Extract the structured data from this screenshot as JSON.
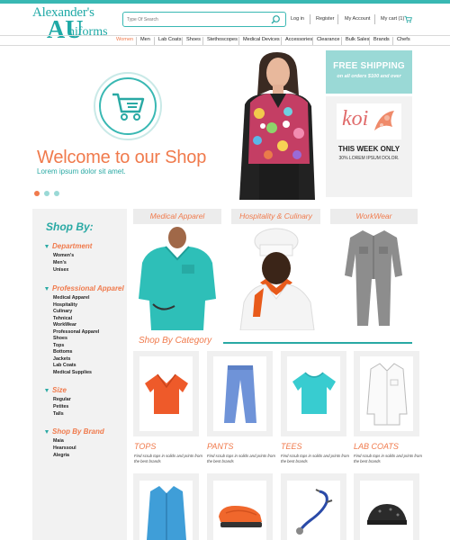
{
  "brand": {
    "line1": "Alexander's",
    "letter_a": "A",
    "letter_u": "U",
    "line2": "niforms"
  },
  "search": {
    "placeholder": "Type Of Search"
  },
  "header_links": {
    "login": "Log in",
    "register": "Register",
    "account": "My Account",
    "cart": "My cart (1)"
  },
  "nav": [
    "Women",
    "Men",
    "Lab Coats",
    "Shoes",
    "Stethoscopes",
    "Medical Devices",
    "Accessories",
    "Clearance",
    "Bulk Sales",
    "Brands",
    "Chefs"
  ],
  "hero": {
    "title": "Welcome to our Shop",
    "subtitle": "Lorem ipsum dolor sit amet.",
    "dots": [
      "active",
      "inactive",
      "inactive"
    ]
  },
  "promo": {
    "shipping_title": "FREE SHIPPING",
    "shipping_sub": "on all orders $100 and over",
    "brand": "koi",
    "this_week": "THIS WEEK ONLY",
    "discount": "30% LOREM IPSUM DOLOR."
  },
  "sidebar": {
    "title": "Shop By:",
    "department": {
      "title": "Department",
      "items": [
        "Women's",
        "Men's",
        "Unisex"
      ]
    },
    "professional": {
      "title": "Professional Apparel",
      "items": [
        "Medical Apparel",
        "Hospitality",
        "Culinary",
        "Tehnical",
        "WorkWear",
        "Professonal Apparel",
        "Shoes",
        "Tops",
        "Bottoms",
        "Jackets",
        "Lab Coats",
        "Medical Supplies"
      ]
    },
    "size": {
      "title": "Size",
      "items": [
        "Regular",
        "Petites",
        "Talls"
      ]
    },
    "brand": {
      "title": "Shop By Brand",
      "items": [
        "Maia",
        "Hearssoul",
        "Alegria"
      ]
    }
  },
  "categories": [
    "Medical Apparel",
    "Hospitality & Culinary",
    "WorkWear"
  ],
  "shop_by_category": "Shop By Category",
  "products": [
    {
      "title": "TOPS",
      "desc": "Find scrub tops in solids and prints from the best brands"
    },
    {
      "title": "PANTS",
      "desc": "Find scrub tops in solids and prints from the best brands"
    },
    {
      "title": "TEES",
      "desc": "Find scrub tops in solids and prints from the best brands"
    },
    {
      "title": "LAB COATS",
      "desc": "Find scrub tops in solids and prints from the best brands"
    }
  ],
  "colors": {
    "accent": "#39b8b3",
    "orange": "#f07a4c",
    "panel": "#f2f2f2"
  }
}
